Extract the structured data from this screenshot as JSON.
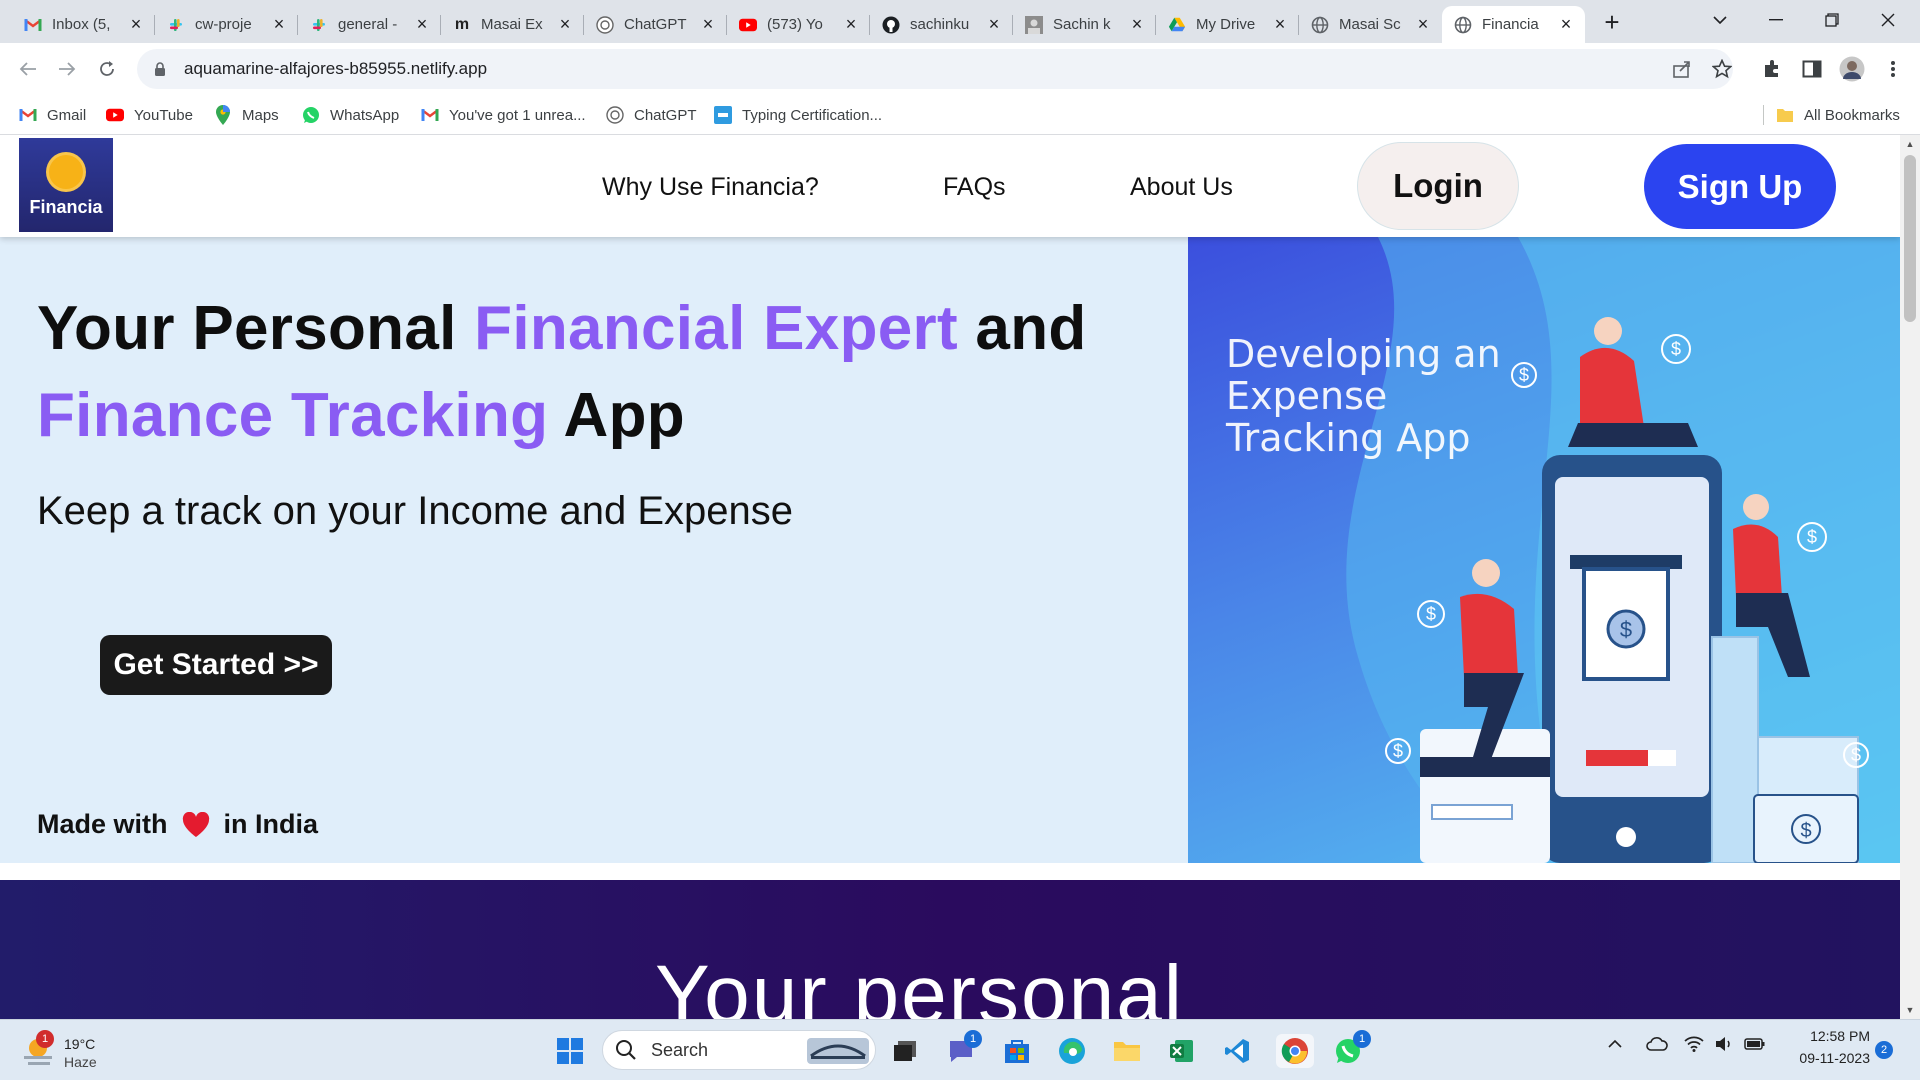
{
  "browser": {
    "tabs": [
      {
        "label": "Inbox (5,",
        "icon": "gmail-icon"
      },
      {
        "label": "cw-proje",
        "icon": "slack-icon"
      },
      {
        "label": "general -",
        "icon": "slack-icon"
      },
      {
        "label": "Masai Ex",
        "icon": "masai-icon"
      },
      {
        "label": "ChatGPT",
        "icon": "chatgpt-icon"
      },
      {
        "label": "(573) Yo",
        "icon": "youtube-icon"
      },
      {
        "label": "sachinku",
        "icon": "github-icon"
      },
      {
        "label": "Sachin k",
        "icon": "profile-icon"
      },
      {
        "label": "My Drive",
        "icon": "drive-icon"
      },
      {
        "label": "Masai Sc",
        "icon": "globe-icon"
      },
      {
        "label": "Financia",
        "icon": "globe-icon",
        "active": true
      }
    ],
    "url": "aquamarine-alfajores-b85955.netlify.app",
    "bookmarks": [
      {
        "label": "Gmail",
        "icon": "gmail-icon"
      },
      {
        "label": "YouTube",
        "icon": "youtube-icon"
      },
      {
        "label": "Maps",
        "icon": "maps-icon"
      },
      {
        "label": "WhatsApp",
        "icon": "whatsapp-icon"
      },
      {
        "label": "You've got 1 unrea...",
        "icon": "gmail-icon"
      },
      {
        "label": "ChatGPT",
        "icon": "chatgpt-icon"
      },
      {
        "label": "Typing Certification...",
        "icon": "typing-icon"
      }
    ],
    "all_bookmarks": "All Bookmarks"
  },
  "site": {
    "logo_text": "Financia",
    "nav": [
      "Why Use Financia?",
      "FAQs",
      "About Us"
    ],
    "login": "Login",
    "signup": "Sign Up",
    "hero": {
      "title_part1": "Your Personal ",
      "title_highlight1": "Financial Expert",
      "title_part2": " and",
      "title_highlight2": "Finance Tracking",
      "title_part3": " App",
      "subtitle": "Keep a track on your Income and Expense",
      "cta": "Get Started >>",
      "made_prefix": "Made with",
      "made_suffix": "in India"
    },
    "illustration_caption": [
      "Developing an",
      "Expense",
      "Tracking App"
    ],
    "section2_heading": "Your personal"
  },
  "taskbar": {
    "weather_temp": "19°C",
    "weather_desc": "Haze",
    "weather_badge": "1",
    "search": "Search",
    "teams_badge": "1",
    "whatsapp_badge": "1",
    "time": "12:58 PM",
    "date": "09-11-2023",
    "notif_count": "2"
  },
  "colors": {
    "accent_purple": "#8a5cf3",
    "signup_blue": "#2b44f0",
    "hero_bg": "#e0eefa"
  }
}
